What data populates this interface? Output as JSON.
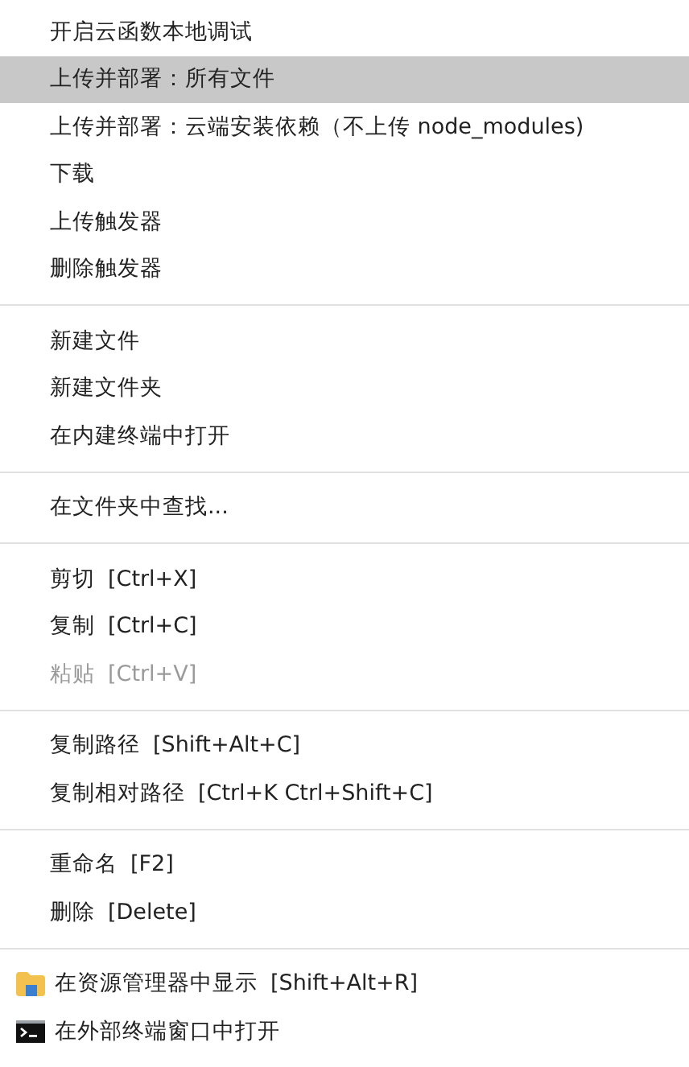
{
  "menu": {
    "groups": [
      [
        {
          "kind": "plain",
          "label": "开启云函数本地调试",
          "selected": false,
          "disabled": false
        },
        {
          "kind": "plain",
          "label": "上传并部署：所有文件",
          "selected": true,
          "disabled": false
        },
        {
          "kind": "plain",
          "label": "上传并部署：云端安装依赖（不上传 node_modules)",
          "selected": false,
          "disabled": false
        },
        {
          "kind": "plain",
          "label": "下载",
          "selected": false,
          "disabled": false
        },
        {
          "kind": "plain",
          "label": "上传触发器",
          "selected": false,
          "disabled": false
        },
        {
          "kind": "plain",
          "label": "删除触发器",
          "selected": false,
          "disabled": false
        }
      ],
      [
        {
          "kind": "plain",
          "label": "新建文件",
          "selected": false,
          "disabled": false
        },
        {
          "kind": "plain",
          "label": "新建文件夹",
          "selected": false,
          "disabled": false
        },
        {
          "kind": "plain",
          "label": "在内建终端中打开",
          "selected": false,
          "disabled": false
        }
      ],
      [
        {
          "kind": "plain",
          "label": "在文件夹中查找...",
          "selected": false,
          "disabled": false
        }
      ],
      [
        {
          "kind": "plain",
          "label": "剪切",
          "shortcut": "[Ctrl+X]",
          "selected": false,
          "disabled": false
        },
        {
          "kind": "plain",
          "label": "复制",
          "shortcut": "[Ctrl+C]",
          "selected": false,
          "disabled": false
        },
        {
          "kind": "plain",
          "label": "粘贴",
          "shortcut": "[Ctrl+V]",
          "selected": false,
          "disabled": true
        }
      ],
      [
        {
          "kind": "plain",
          "label": "复制路径",
          "shortcut": "[Shift+Alt+C]",
          "selected": false,
          "disabled": false
        },
        {
          "kind": "plain",
          "label": "复制相对路径",
          "shortcut": "[Ctrl+K Ctrl+Shift+C]",
          "selected": false,
          "disabled": false
        }
      ],
      [
        {
          "kind": "plain",
          "label": "重命名",
          "shortcut": "[F2]",
          "selected": false,
          "disabled": false
        },
        {
          "kind": "plain",
          "label": "删除",
          "shortcut": "[Delete]",
          "selected": false,
          "disabled": false
        }
      ],
      [
        {
          "kind": "folder",
          "label": "在资源管理器中显示",
          "shortcut": "[Shift+Alt+R]",
          "selected": false,
          "disabled": false
        },
        {
          "kind": "terminal",
          "label": "在外部终端窗口中打开",
          "selected": false,
          "disabled": false
        }
      ]
    ]
  }
}
